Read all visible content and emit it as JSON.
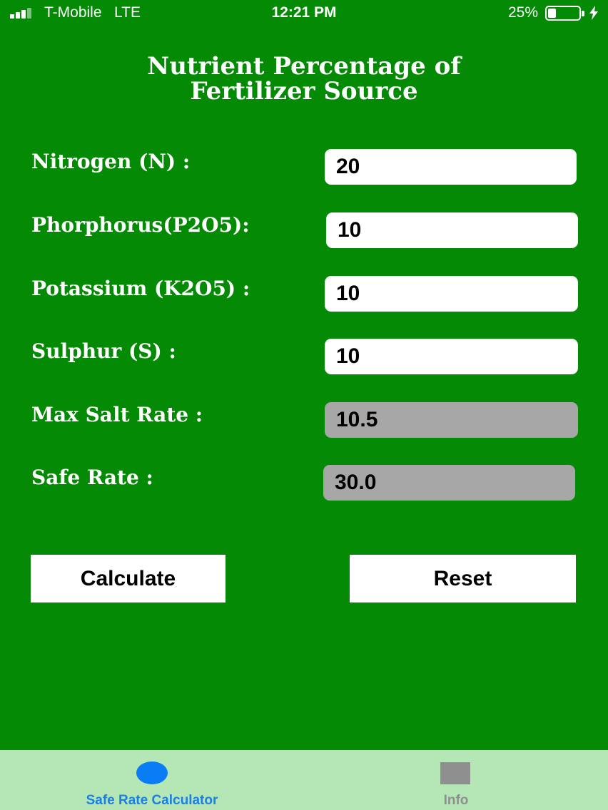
{
  "status_bar": {
    "carrier": "T-Mobile",
    "network": "LTE",
    "time": "12:21 PM",
    "battery_percent": "25%",
    "battery_level": 0.25
  },
  "title": "Nutrient Percentage of Fertilizer Source",
  "fields": {
    "nitrogen": {
      "label": "Nitrogen (N) :",
      "value": "20"
    },
    "phosphorus": {
      "label": "Phorphorus(P2O5):",
      "value": "10"
    },
    "potassium": {
      "label": "Potassium (K2O5) :",
      "value": "10"
    },
    "sulphur": {
      "label": "Sulphur (S) :",
      "value": "10"
    },
    "max_salt_rate": {
      "label": "Max Salt Rate :",
      "value": "10.5"
    },
    "safe_rate": {
      "label": "Safe Rate :",
      "value": "30.0"
    }
  },
  "buttons": {
    "calculate": "Calculate",
    "reset": "Reset"
  },
  "tabs": [
    {
      "label": "Safe Rate Calculator",
      "icon": "circle-icon",
      "active": true,
      "color": "#0a7cf5"
    },
    {
      "label": "Info",
      "icon": "square-icon",
      "active": false,
      "color": "#8f8f8f"
    }
  ],
  "colors": {
    "background": "#048a04",
    "tab_bar": "#b5e6b5",
    "readonly_field": "#a7a7a7"
  }
}
